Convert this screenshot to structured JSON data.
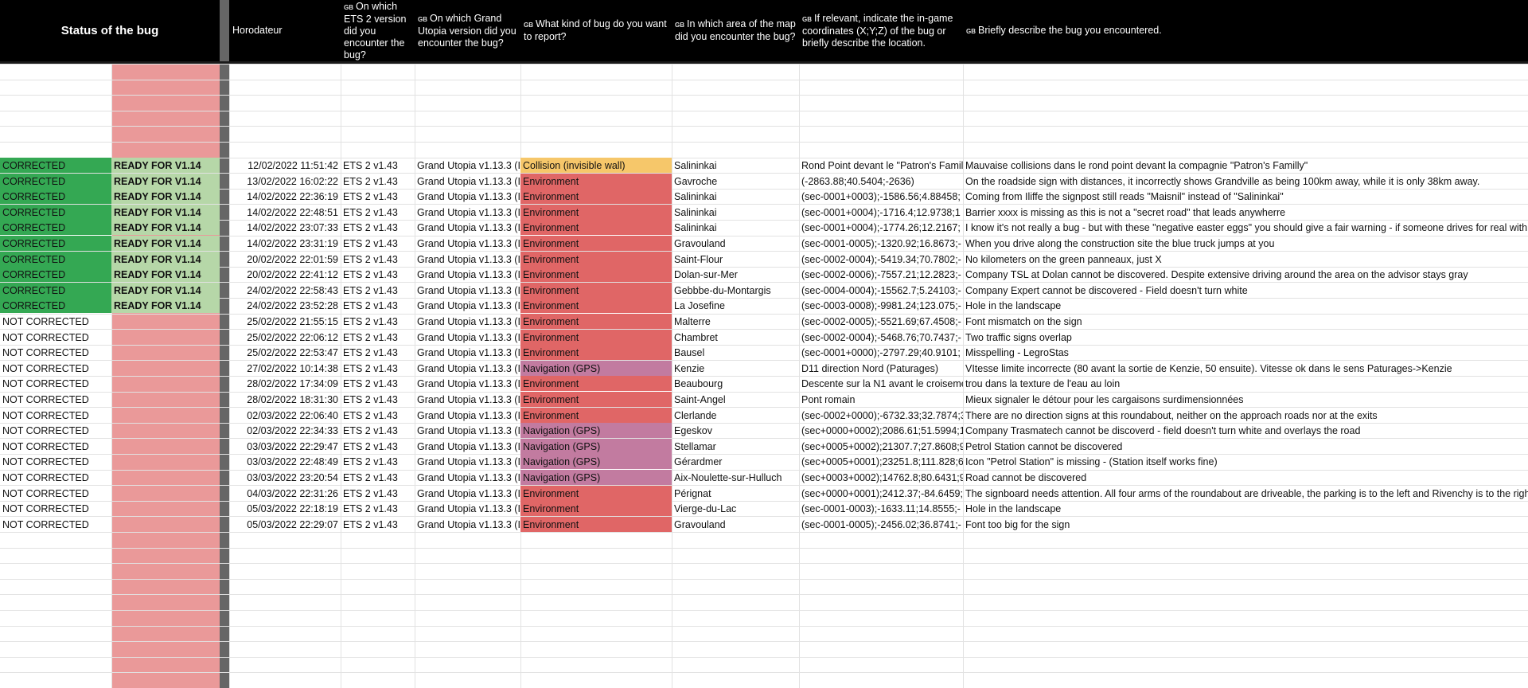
{
  "headers": {
    "status": "Status of the bug",
    "timestamp": "Horodateur",
    "ets_version": "On which ETS 2 version did you encounter the bug?",
    "gu_version": "On which Grand Utopia version did you encounter the bug?",
    "bug_kind": "What kind of bug do you want to report?",
    "map_area": "In which area of the map did you encounter the bug?",
    "coordinates": "If relevant, indicate the in-game coordinates (X;Y;Z) of the bug or briefly describe the location.",
    "description": "Briefly describe the bug you encountered.",
    "flag": "GB"
  },
  "colors": {
    "corrected": "#34a853",
    "ready": "#b6d7a8",
    "pending_column": "#ea9999",
    "environment": "#e06666",
    "navigation": "#c27ba0",
    "collision": "#f6c76a",
    "header_bg": "#000000"
  },
  "rows": [
    {
      "status": "CORRECTED",
      "ready": "READY FOR V1.14",
      "time": "12/02/2022 11:51:42",
      "ets": "ETS 2 v1.43",
      "gu": "Grand Utopia v1.13.3 (I",
      "kind": "Collision (invisible wall)",
      "kind_class": "k-col",
      "area": "Salininkai",
      "coord": "Rond Point devant le \"Patron's Famil",
      "desc": "Mauvaise collisions dans le rond point devant la compagnie \"Patron's Familly\""
    },
    {
      "status": "CORRECTED",
      "ready": "READY FOR V1.14",
      "time": "13/02/2022 16:02:22",
      "ets": "ETS 2 v1.43",
      "gu": "Grand Utopia v1.13.3 (I",
      "kind": "Environment",
      "kind_class": "k-env",
      "area": "Gavroche",
      "coord": "(-2863.88;40.5404;-2636)",
      "desc": "On the roadside sign with distances, it incorrectly shows Grandville as being 100km away, while it is only 38km away."
    },
    {
      "status": "CORRECTED",
      "ready": "READY FOR V1.14",
      "time": "14/02/2022 22:36:19",
      "ets": "ETS 2 v1.43",
      "gu": "Grand Utopia v1.13.3 (I",
      "kind": "Environment",
      "kind_class": "k-env",
      "area": "Salininkai",
      "coord": "(sec-0001+0003);-1586.56;4.88458;",
      "desc": "Coming from Iliffe the signpost still reads \"Maisnil\" instead of \"Salininkai\""
    },
    {
      "status": "CORRECTED",
      "ready": "READY FOR V1.14",
      "time": "14/02/2022 22:48:51",
      "ets": "ETS 2 v1.43",
      "gu": "Grand Utopia v1.13.3 (I",
      "kind": "Environment",
      "kind_class": "k-env",
      "area": "Salininkai",
      "coord": " (sec-0001+0004);-1716.4;12.9738;1",
      "desc": "Barrier xxxx is missing as this is not a \"secret road\" that leads anywherre"
    },
    {
      "status": "CORRECTED",
      "ready": "READY FOR V1.14",
      "time": "14/02/2022 23:07:33",
      "ets": "ETS 2 v1.43",
      "gu": "Grand Utopia v1.13.3 (I",
      "kind": "Environment",
      "kind_class": "k-env",
      "area": "Salininkai",
      "coord": "(sec-0001+0004);-1774.26;12.2167;",
      "desc": "I know it's not really a bug - but with these \"negative easter eggs\" you should give a fair warning - if someone drives for real with"
    },
    {
      "status": "CORRECTED",
      "ready": "READY FOR V1.14",
      "time": "14/02/2022 23:31:19",
      "ets": "ETS 2 v1.43",
      "gu": "Grand Utopia v1.13.3 (I",
      "kind": "Environment",
      "kind_class": "k-env",
      "area": "Gravouland",
      "coord": "(sec-0001-0005);-1320.92;16.8673;-",
      "desc": "When you drive along the construction site the blue truck jumps at you"
    },
    {
      "status": "CORRECTED",
      "ready": "READY FOR V1.14",
      "time": "20/02/2022 22:01:59",
      "ets": "ETS 2 v1.43",
      "gu": "Grand Utopia v1.13.3 (I",
      "kind": "Environment",
      "kind_class": "k-env",
      "area": "Saint-Flour",
      "coord": "(sec-0002-0004);-5419.34;70.7802;-",
      "desc": "No kilometers on the green panneaux, just X"
    },
    {
      "status": "CORRECTED",
      "ready": "READY FOR V1.14",
      "time": "20/02/2022 22:41:12",
      "ets": "ETS 2 v1.43",
      "gu": "Grand Utopia v1.13.3 (I",
      "kind": "Environment",
      "kind_class": "k-env",
      "area": "Dolan-sur-Mer",
      "coord": "(sec-0002-0006);-7557.21;12.2823;-",
      "desc": "Company TSL at Dolan cannot be discovered. Despite extensive driving around the area on the advisor stays gray"
    },
    {
      "status": "CORRECTED",
      "ready": "READY FOR V1.14",
      "time": "24/02/2022 22:58:43",
      "ets": "ETS 2 v1.43",
      "gu": "Grand Utopia v1.13.3 (I",
      "kind": "Environment",
      "kind_class": "k-env",
      "area": "Gebbbe-du-Montargis",
      "coord": "(sec-0004-0004);-15562.7;5.24103;-",
      "desc": "Company Expert cannot be discovered - Field doesn't turn white"
    },
    {
      "status": "CORRECTED",
      "ready": "READY FOR V1.14",
      "time": "24/02/2022 23:52:28",
      "ets": "ETS 2 v1.43",
      "gu": "Grand Utopia v1.13.3 (I",
      "kind": "Environment",
      "kind_class": "k-env",
      "area": "La Josefine",
      "coord": "(sec-0003-0008);-9981.24;123.075;-",
      "desc": "Hole in the landscape"
    },
    {
      "status": "NOT CORRECTED",
      "ready": "",
      "time": "25/02/2022 21:55:15",
      "ets": "ETS 2 v1.43",
      "gu": "Grand Utopia v1.13.3 (I",
      "kind": "Environment",
      "kind_class": "k-env",
      "area": "Malterre",
      "coord": "(sec-0002-0005);-5521.69;67.4508;-",
      "desc": "Font mismatch on the sign"
    },
    {
      "status": "NOT CORRECTED",
      "ready": "",
      "time": "25/02/2022 22:06:12",
      "ets": "ETS 2 v1.43",
      "gu": "Grand Utopia v1.13.3 (I",
      "kind": "Environment",
      "kind_class": "k-env",
      "area": "Chambret",
      "coord": "(sec-0002-0004);-5468.76;70.7437;-",
      "desc": "Two traffic signs overlap"
    },
    {
      "status": "NOT CORRECTED",
      "ready": "",
      "time": "25/02/2022 22:53:47",
      "ets": "ETS 2 v1.43",
      "gu": "Grand Utopia v1.13.3 (I",
      "kind": "Environment",
      "kind_class": "k-env",
      "area": "Bausel",
      "coord": "(sec-0001+0000);-2797.29;40.9101;",
      "desc": "Misspelling - LegroStas"
    },
    {
      "status": "NOT CORRECTED",
      "ready": "",
      "time": "27/02/2022 10:14:38",
      "ets": "ETS 2 v1.43",
      "gu": "Grand Utopia v1.13.3 (I",
      "kind": "Navigation (GPS)",
      "kind_class": "k-nav",
      "area": "Kenzie",
      "coord": "D11 direction Nord (Paturages)",
      "desc": "VItesse limite incorrecte (80 avant la sortie de Kenzie, 50 ensuite). Vitesse ok dans le sens Paturages->Kenzie"
    },
    {
      "status": "NOT CORRECTED",
      "ready": "",
      "time": "28/02/2022 17:34:09",
      "ets": "ETS 2 v1.43",
      "gu": "Grand Utopia v1.13.3 (I",
      "kind": "Environment",
      "kind_class": "k-env",
      "area": "Beaubourg",
      "coord": "Descente sur la N1 avant le croiseme",
      "desc": "trou dans la texture de l'eau au loin"
    },
    {
      "status": "NOT CORRECTED",
      "ready": "",
      "time": "28/02/2022 18:31:30",
      "ets": "ETS 2 v1.43",
      "gu": "Grand Utopia v1.13.3 (I",
      "kind": "Environment",
      "kind_class": "k-env",
      "area": "Saint-Angel",
      "coord": "Pont romain",
      "desc": "Mieux signaler le détour pour les cargaisons surdimensionnées"
    },
    {
      "status": "NOT CORRECTED",
      "ready": "",
      "time": "02/03/2022 22:06:40",
      "ets": "ETS 2 v1.43",
      "gu": "Grand Utopia v1.13.3 (I",
      "kind": "Environment",
      "kind_class": "k-env",
      "area": "Clerlande",
      "coord": "(sec-0002+0000);-6732.33;32.7874;3",
      "desc": "There are no direction signs at this roundabout, neither on the approach roads nor at the exits"
    },
    {
      "status": "NOT CORRECTED",
      "ready": "",
      "time": "02/03/2022 22:34:33",
      "ets": "ETS 2 v1.43",
      "gu": "Grand Utopia v1.13.3 (I",
      "kind": "Navigation (GPS)",
      "kind_class": "k-nav",
      "area": "Egeskov",
      "coord": "(sec+0000+0002);2086.61;51.5994;1",
      "desc": "Company Trasmatech cannot  be discoverd - field doesn't turn white and overlays the road"
    },
    {
      "status": "NOT CORRECTED",
      "ready": "",
      "time": "03/03/2022 22:29:47",
      "ets": "ETS 2 v1.43",
      "gu": "Grand Utopia v1.13.3 (I",
      "kind": "Navigation (GPS)",
      "kind_class": "k-nav",
      "area": "Stellamar",
      "coord": "(sec+0005+0002);21307.7;27.8608;9",
      "desc": "Petrol Station cannot be discovered"
    },
    {
      "status": "NOT CORRECTED",
      "ready": "",
      "time": "03/03/2022 22:48:49",
      "ets": "ETS 2 v1.43",
      "gu": "Grand Utopia v1.13.3 (I",
      "kind": "Navigation (GPS)",
      "kind_class": "k-nav",
      "area": "Gérardmer",
      "coord": "(sec+0005+0001);23251.8;111.828;6",
      "desc": "Icon \"Petrol Station\" is missing - (Station itself works fine)"
    },
    {
      "status": "NOT CORRECTED",
      "ready": "",
      "time": "03/03/2022 23:20:54",
      "ets": "ETS 2 v1.43",
      "gu": "Grand Utopia v1.13.3 (I",
      "kind": "Navigation (GPS)",
      "kind_class": "k-nav",
      "area": "Aix-Noulette-sur-Hulluch",
      "coord": "(sec+0003+0002);14762.8;80.6431;9",
      "desc": "Road cannot be discovered"
    },
    {
      "status": "NOT CORRECTED",
      "ready": "",
      "time": "04/03/2022 22:31:26",
      "ets": "ETS 2 v1.43",
      "gu": "Grand Utopia v1.13.3 (I",
      "kind": "Environment",
      "kind_class": "k-env",
      "area": "Pérignat",
      "coord": "(sec+0000+0001);2412.37;-84.6459;",
      "desc": "The signboard needs attention. All four arms of the roundabout are driveable, the parking is to the left and Rivenchy is to the righ"
    },
    {
      "status": "NOT CORRECTED",
      "ready": "",
      "time": "05/03/2022 22:18:19",
      "ets": "ETS 2 v1.43",
      "gu": "Grand Utopia v1.13.3 (I",
      "kind": "Environment",
      "kind_class": "k-env",
      "area": "Vierge-du-Lac",
      "coord": "(sec-0001-0003);-1633.11;14.8555;-",
      "desc": "Hole in the landscape"
    },
    {
      "status": "NOT CORRECTED",
      "ready": "",
      "time": "05/03/2022 22:29:07",
      "ets": "ETS 2 v1.43",
      "gu": "Grand Utopia v1.13.3 (I",
      "kind": "Environment",
      "kind_class": "k-env",
      "area": "Gravouland",
      "coord": "(sec-0001-0005);-2456.02;36.8741;-",
      "desc": "Font too big for the sign"
    }
  ]
}
